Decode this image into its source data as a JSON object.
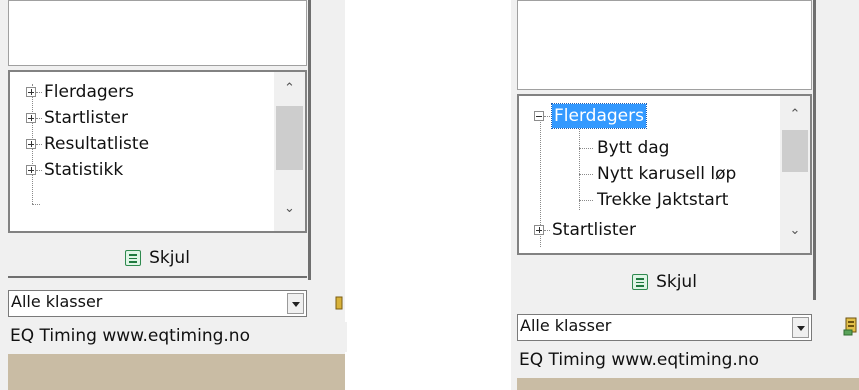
{
  "left_panel": {
    "tree_items": [
      {
        "label": "Flerdagers"
      },
      {
        "label": "Startlister"
      },
      {
        "label": "Resultatliste"
      },
      {
        "label": "Statistikk"
      }
    ],
    "hide_button_label": "Skjul",
    "class_select_value": "Alle klasser",
    "status_text": "EQ Timing www.eqtiming.no"
  },
  "right_panel": {
    "tree_items": [
      {
        "label": "Flerdagers",
        "expanded": true,
        "selected": true
      },
      {
        "label": "Bytt dag",
        "child": true
      },
      {
        "label": "Nytt karusell løp",
        "child": true
      },
      {
        "label": "Trekke Jaktstart",
        "child": true
      },
      {
        "label": "Startlister"
      }
    ],
    "hide_button_label": "Skjul",
    "class_select_value": "Alle klasser",
    "status_text": "EQ Timing www.eqtiming.no"
  },
  "icons": {
    "expand": "plus-box-icon",
    "collapse": "minus-box-icon",
    "scroll_up": "chevron-up-icon",
    "scroll_down": "chevron-down-icon",
    "hide": "list-icon",
    "toolbar": "tool-icon"
  }
}
